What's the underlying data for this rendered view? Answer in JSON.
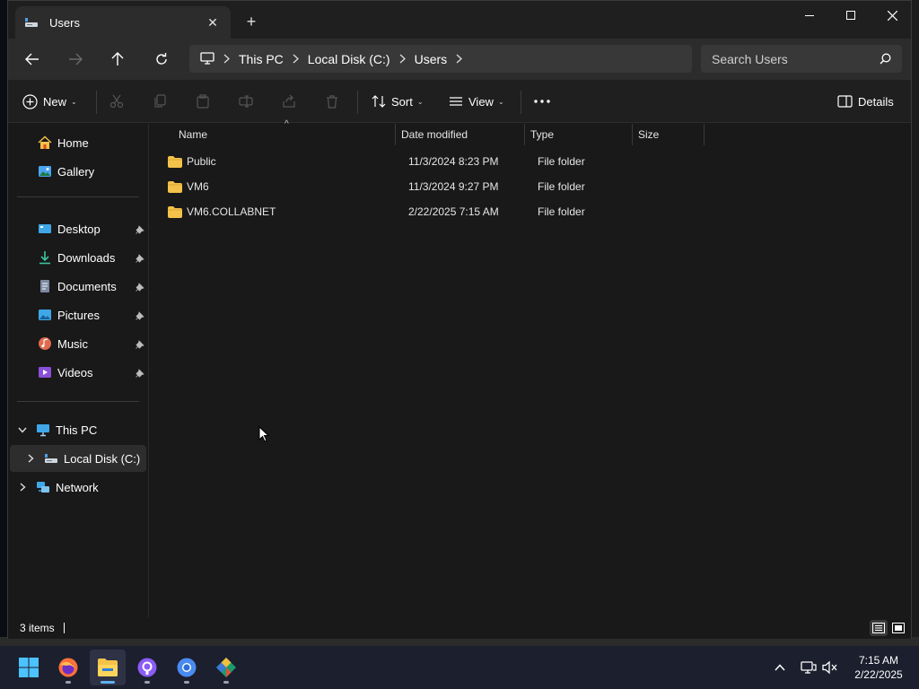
{
  "window": {
    "tab_title": "Users",
    "tab_close": "✕",
    "new_tab": "+"
  },
  "navigation": {
    "breadcrumbs": [
      "This PC",
      "Local Disk (C:)",
      "Users"
    ],
    "search_placeholder": "Search Users"
  },
  "commands": {
    "new_label": "New",
    "sort_label": "Sort",
    "view_label": "View",
    "details_label": "Details",
    "caret": "⌄"
  },
  "sidebar": {
    "home": "Home",
    "gallery": "Gallery",
    "quick_access": [
      {
        "label": "Desktop",
        "icon": "desktop-icon",
        "pinned": true
      },
      {
        "label": "Downloads",
        "icon": "downloads-icon",
        "pinned": true
      },
      {
        "label": "Documents",
        "icon": "documents-icon",
        "pinned": true
      },
      {
        "label": "Pictures",
        "icon": "pictures-icon",
        "pinned": true
      },
      {
        "label": "Music",
        "icon": "music-icon",
        "pinned": true
      },
      {
        "label": "Videos",
        "icon": "videos-icon",
        "pinned": true
      }
    ],
    "this_pc": "This PC",
    "local_disk": "Local Disk (C:)",
    "network": "Network"
  },
  "file_list": {
    "columns": [
      "Name",
      "Date modified",
      "Type",
      "Size"
    ],
    "sort_indicator": "^",
    "rows": [
      {
        "name": "Public",
        "date": "11/3/2024 8:23 PM",
        "type": "File folder",
        "size": ""
      },
      {
        "name": "VM6",
        "date": "11/3/2024 9:27 PM",
        "type": "File folder",
        "size": ""
      },
      {
        "name": "VM6.COLLABNET",
        "date": "2/22/2025 7:15 AM",
        "type": "File folder",
        "size": ""
      }
    ]
  },
  "status": {
    "item_count": "3 items"
  },
  "taskbar": {
    "apps": [
      "start",
      "firefox",
      "file-explorer",
      "github-desktop",
      "chrome",
      "git"
    ],
    "active_app": "file-explorer",
    "time": "7:15 AM",
    "date": "2/22/2025"
  },
  "colors": {
    "folder": "#f3c24a",
    "accent": "#5fb2f2",
    "window_bg": "#191919"
  }
}
